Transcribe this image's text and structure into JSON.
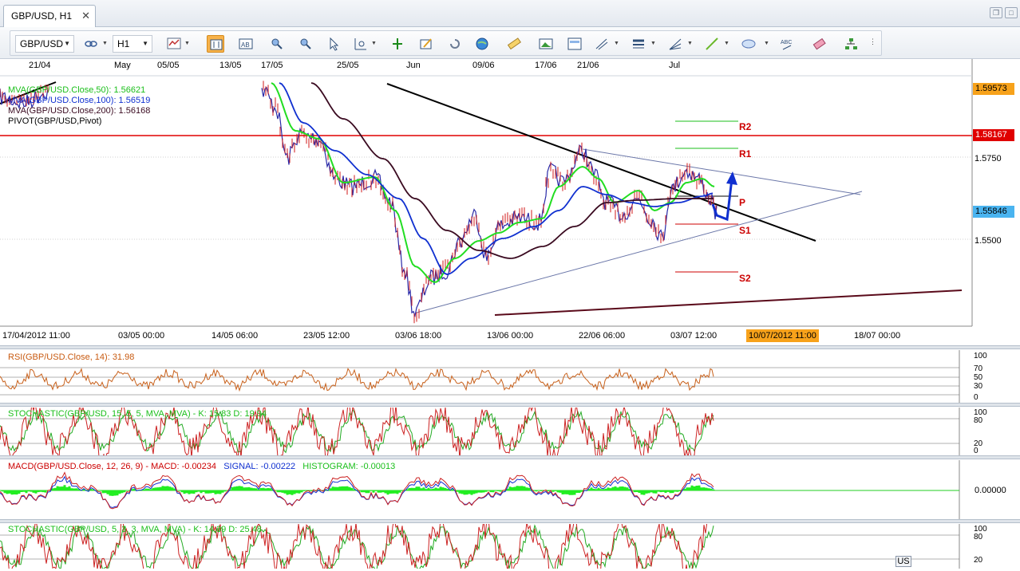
{
  "tab": {
    "label": "GBP/USD, H1"
  },
  "toolbar": {
    "symbol": "GBP/USD",
    "timeframe": "H1"
  },
  "top_dates": [
    "21/04",
    "May",
    "05/05",
    "13/05",
    "17/05",
    "25/05",
    "Jun",
    "09/06",
    "17/06",
    "21/06",
    "Jul"
  ],
  "bottom_dates": [
    "17/04/2012 11:00",
    "03/05 00:00",
    "14/05 06:00",
    "23/05 12:00",
    "03/06 18:00",
    "13/06 00:00",
    "22/06 06:00",
    "03/07 12:00",
    "10/07/2012 11:00",
    "18/07 00:00"
  ],
  "legend": {
    "ma50": "MVA(GBP/USD.Close,50): 1.56621",
    "ma100": "MVA(GBP/USD.Close,100): 1.56519",
    "ma200": "MVA(GBP/USD.Close,200): 1.56168",
    "pivot": "PIVOT(GBP/USD,Pivot)"
  },
  "pivots": {
    "r2": "R2",
    "r1": "R1",
    "p": "P",
    "s1": "S1",
    "s2": "S2"
  },
  "price_axis": {
    "tag_high": "1.59573",
    "tag_res": "1.58167",
    "tag_last": "1.55846",
    "tick_1": "1.5750",
    "tick_2": "1.5500"
  },
  "rsi": {
    "label": "RSI(GBP/USD.Close, 14): 31.98",
    "ticks": [
      "100",
      "70",
      "50",
      "30",
      "0"
    ]
  },
  "stoch1": {
    "label": "STOCHASTIC(GBP/USD, 15, 5, 5, MVA, MVA) -  K: 15.83  D: 19.94",
    "ticks": [
      "100",
      "80",
      "20",
      "0"
    ]
  },
  "macd": {
    "label_name": "MACD(GBP/USD.Close, 12, 26, 9) -  MACD: -0.00234",
    "label_signal": "SIGNAL: -0.00222",
    "label_hist": "HISTOGRAM: -0.00013",
    "tick": "0.00000"
  },
  "stoch2": {
    "label": "STOCHASTIC(GBP/USD, 5, 3, 3, MVA, MVA) -  K: 14.39  D: 25.48",
    "ticks": [
      "100",
      "80",
      "20"
    ]
  },
  "currency_badge": "US",
  "colors": {
    "accent_orange": "#f7a21b",
    "resistance_red": "#e00000",
    "ma50": "#22dd22",
    "ma100": "#1030d0",
    "ma200": "#3a0a20",
    "last_price_blue": "#4ab4f0"
  }
}
